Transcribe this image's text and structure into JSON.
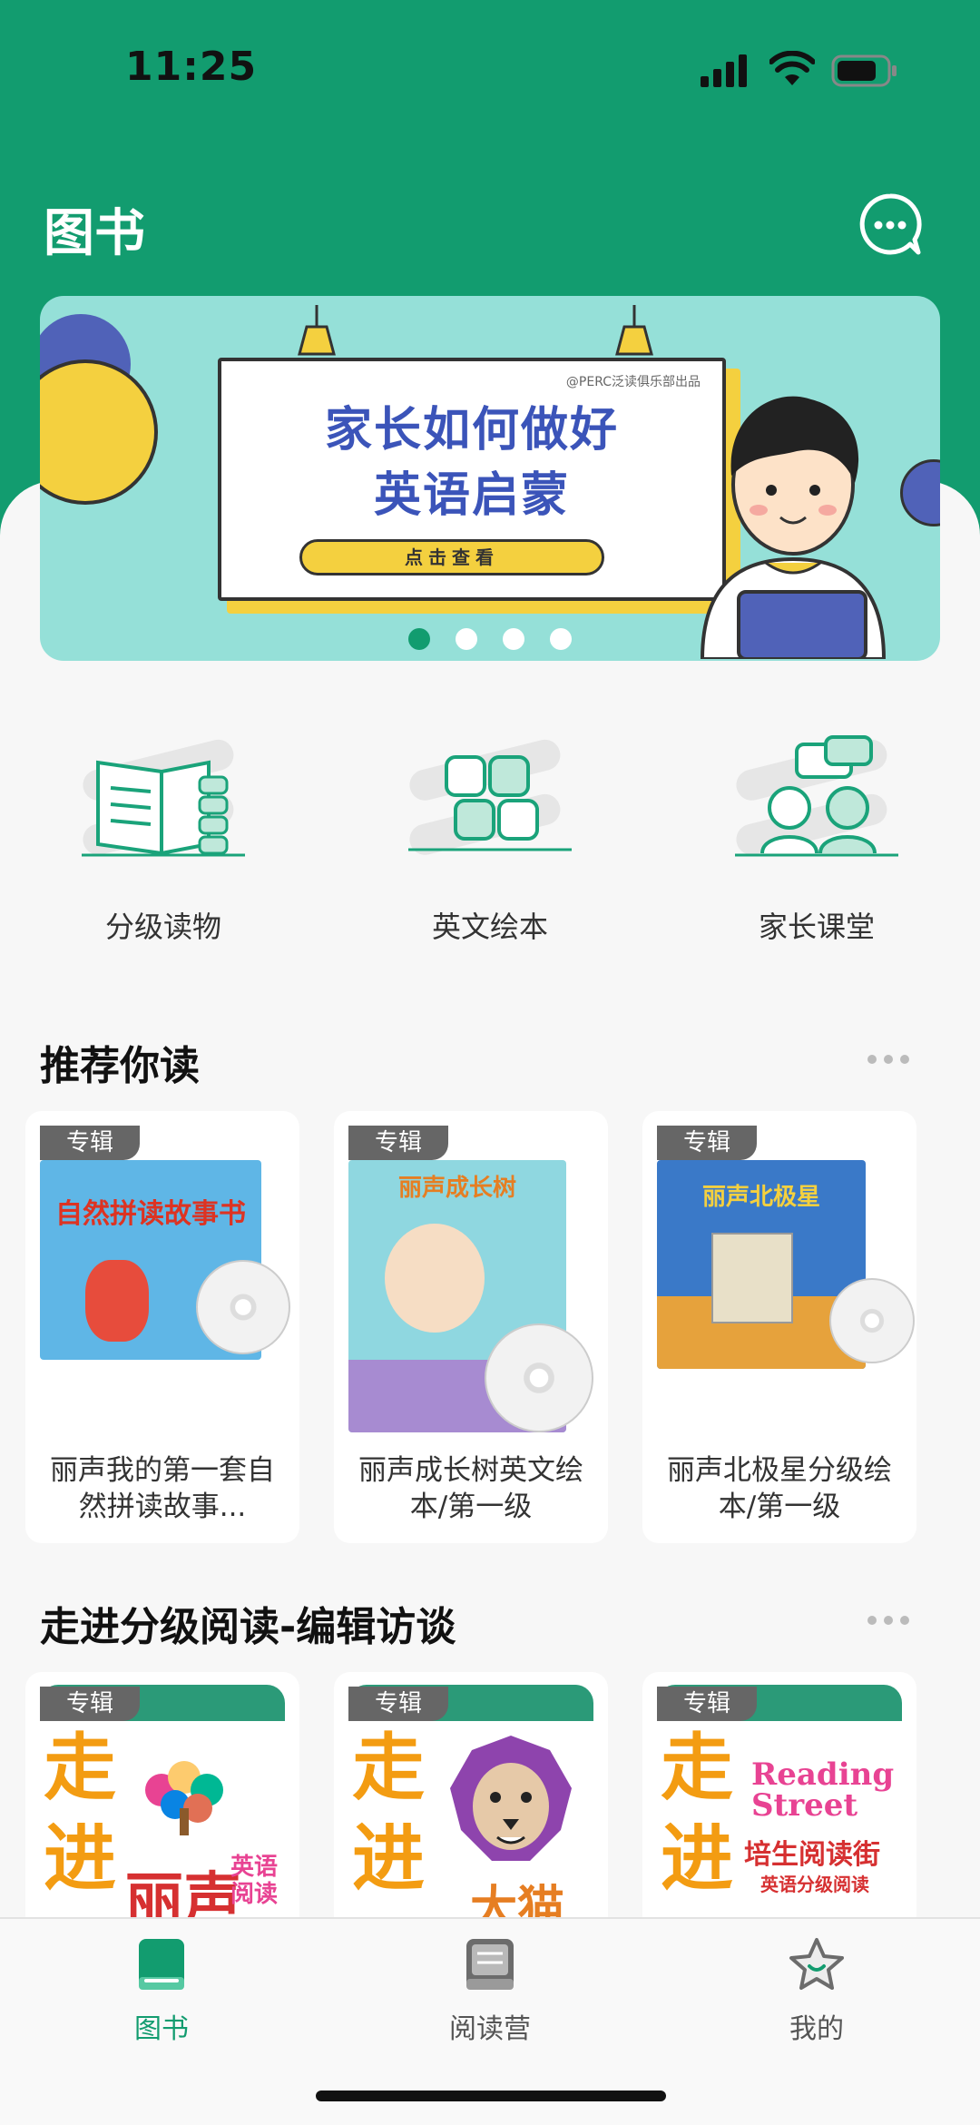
{
  "status_bar": {
    "time": "11:25"
  },
  "header": {
    "title": "图书"
  },
  "banner": {
    "source": "@PERC泛读俱乐部出品",
    "headline_line1": "家长如何做好",
    "headline_line2": "英语启蒙",
    "cta": "点击查看",
    "slide_count": 4,
    "active_slide": 1
  },
  "categories": [
    {
      "label": "分级读物"
    },
    {
      "label": "英文绘本"
    },
    {
      "label": "家长课堂"
    }
  ],
  "recommend": {
    "title": "推荐你读",
    "items": [
      {
        "tag": "专辑",
        "title": "丽声我的第一套自然拼读故事...",
        "cover_text": "自然拼读故事书"
      },
      {
        "tag": "专辑",
        "title": "丽声成长树英文绘本/第一级",
        "cover_text": "丽声成长树"
      },
      {
        "tag": "专辑",
        "title": "丽声北极星分级绘本/第一级",
        "cover_text": "丽声北极星"
      }
    ]
  },
  "interviews": {
    "title": "走进分级阅读-编辑访谈",
    "items": [
      {
        "tag": "专辑",
        "big": "走进",
        "brand": "丽声",
        "sub": "英语阅读"
      },
      {
        "tag": "专辑",
        "big": "走进",
        "brand": "大猫",
        "sub": ""
      },
      {
        "tag": "专辑",
        "big": "走进",
        "brand": "Reading Street",
        "sub": "培生阅读街",
        "sub2": "英语分级阅读"
      }
    ]
  },
  "tab_bar": {
    "items": [
      {
        "label": "图书",
        "active": true
      },
      {
        "label": "阅读营",
        "active": false
      },
      {
        "label": "我的",
        "active": false
      }
    ]
  },
  "colors": {
    "brand_green": "#129c6f",
    "banner_bg": "#95e0d8",
    "banner_text": "#3b54b9",
    "accent_yellow": "#f4d03f",
    "tag_gray": "#666666"
  }
}
